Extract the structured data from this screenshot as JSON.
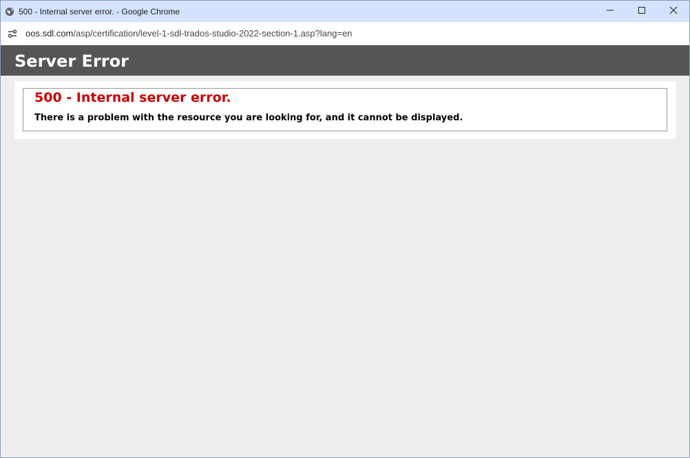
{
  "browser": {
    "title": "500 - Internal server error. - Google Chrome",
    "url_host": "oos.sdl.com",
    "url_path": "/asp/certification/level-1-sdl-trados-studio-2022-section-1.asp?lang=en",
    "favicon": "globe-icon",
    "site_info_icon": "tune-icon",
    "controls": [
      "minimize-icon",
      "maximize-icon",
      "close-icon"
    ]
  },
  "page": {
    "header": "Server Error",
    "error_title": "500 - Internal server error.",
    "error_message": "There is a problem with the resource you are looking for, and it cannot be displayed.",
    "colors": {
      "header_bg": "#555555",
      "error_title": "#cc0000",
      "page_bg": "#eeeeee"
    }
  }
}
